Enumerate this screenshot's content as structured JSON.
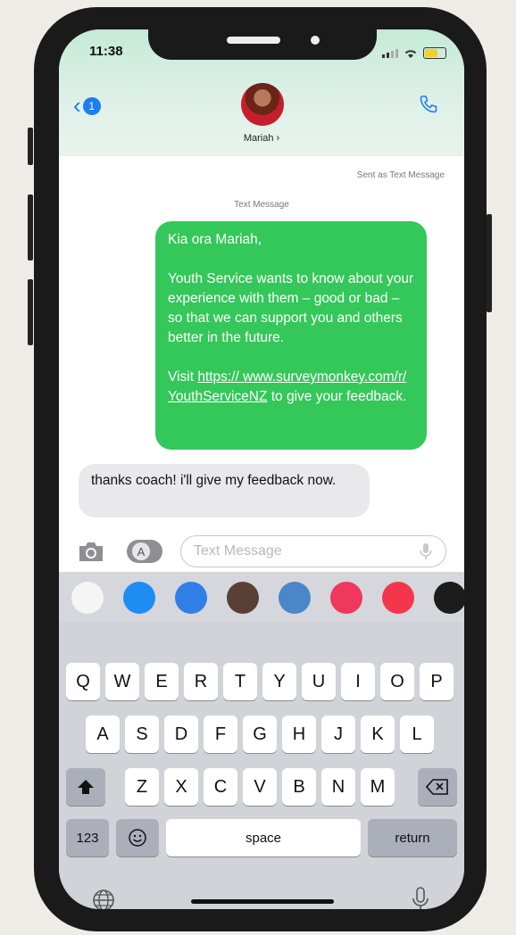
{
  "status": {
    "time": "11:38"
  },
  "header": {
    "back_badge": "1",
    "contact_name": "Mariah ›"
  },
  "meta": {
    "sent_as": "Sent as Text Message",
    "text_message_label": "Text Message"
  },
  "messages": {
    "outgoing": {
      "line1": "Kia ora Mariah,",
      "line2": "Youth Service wants to know about your experience with them – good or bad – so that we can support you and others better in the future.",
      "visit_prefix": "Visit ",
      "link": "https:// www.surveymonkey.com/r/ YouthServiceNZ",
      "visit_suffix": " to give your feedback."
    },
    "incoming": "thanks coach! i'll give my feedback now."
  },
  "composer": {
    "placeholder": "Text Message",
    "apps_glyph": "A"
  },
  "app_strip": [
    {
      "name": "photos-app-icon",
      "color": "#f5f5f5"
    },
    {
      "name": "app-store-icon",
      "color": "#1e8cf3"
    },
    {
      "name": "audio-message-icon",
      "color": "#2f7fe6"
    },
    {
      "name": "memoji-icon",
      "color": "#5a4034"
    },
    {
      "name": "memoji-stickers-icon",
      "color": "#4b86c9"
    },
    {
      "name": "image-search-icon",
      "color": "#f0375c"
    },
    {
      "name": "music-app-icon",
      "color": "#f4364c"
    },
    {
      "name": "fitness-app-icon",
      "color": "#1c1c1c"
    }
  ],
  "keyboard": {
    "row1": [
      "Q",
      "W",
      "E",
      "R",
      "T",
      "Y",
      "U",
      "I",
      "O",
      "P"
    ],
    "row2": [
      "A",
      "S",
      "D",
      "F",
      "G",
      "H",
      "J",
      "K",
      "L"
    ],
    "row3": [
      "Z",
      "X",
      "C",
      "V",
      "B",
      "N",
      "M"
    ],
    "numbers_key": "123",
    "space_key": "space",
    "return_key": "return"
  },
  "colors": {
    "imessage_sms_green": "#34c759",
    "ios_blue": "#1c7ef0",
    "incoming_gray": "#e9e9eb"
  }
}
